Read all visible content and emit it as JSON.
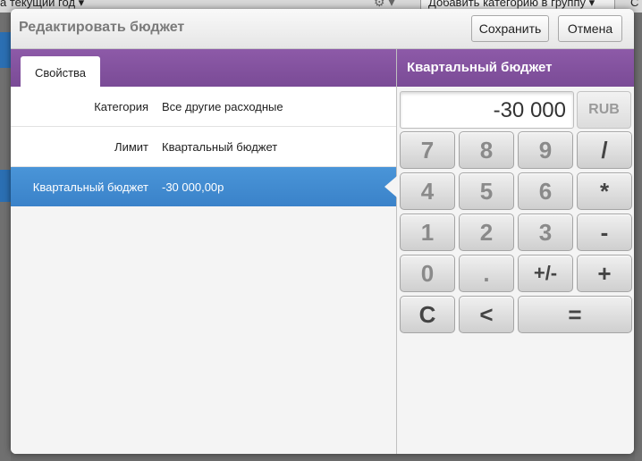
{
  "background": {
    "period_label": "а текущий год",
    "add_category_label": "Добавить категорию в группу",
    "right_fragment": "С"
  },
  "dialog": {
    "title": "Редактировать бюджет",
    "save_label": "Сохранить",
    "cancel_label": "Отмена"
  },
  "properties": {
    "tab_label": "Свойства",
    "rows": [
      {
        "label": "Категория",
        "value": "Все другие расходные"
      },
      {
        "label": "Лимит",
        "value": "Квартальный бюджет"
      },
      {
        "label": "Квартальный бюджет",
        "value": "-30 000,00р"
      }
    ]
  },
  "calculator": {
    "title": "Квартальный бюджет",
    "display_value": "-30 000",
    "currency": "RUB",
    "keys": {
      "k7": "7",
      "k8": "8",
      "k9": "9",
      "divide": "/",
      "k4": "4",
      "k5": "5",
      "k6": "6",
      "multiply": "*",
      "k1": "1",
      "k2": "2",
      "k3": "3",
      "minus": "-",
      "k0": "0",
      "dot": ".",
      "plusminus": "+/-",
      "plus": "+",
      "clear": "C",
      "backspace": "<",
      "equals": "="
    }
  },
  "colors": {
    "header_purple": "#8553a0",
    "selection_blue": "#4a8fd4"
  }
}
